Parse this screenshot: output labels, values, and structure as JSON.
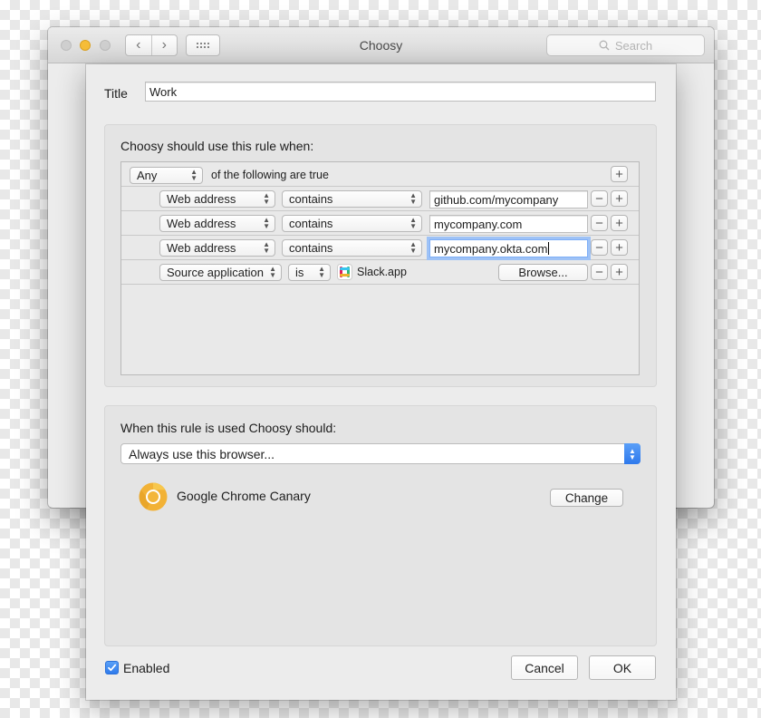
{
  "window": {
    "title": "Choosy",
    "search_placeholder": "Search"
  },
  "sheet": {
    "title_label": "Title",
    "title_value": "Work",
    "condition_header": "Choosy should use this rule when:",
    "match_mode": "Any",
    "match_suffix": "of the following are true",
    "rows": [
      {
        "field": "Web address",
        "operator": "contains",
        "value": "github.com/mycompany"
      },
      {
        "field": "Web address",
        "operator": "contains",
        "value": "mycompany.com"
      },
      {
        "field": "Web address",
        "operator": "contains",
        "value": "mycompany.okta.com"
      }
    ],
    "source_row": {
      "field": "Source application",
      "operator": "is",
      "app_name": "Slack.app",
      "browse_label": "Browse..."
    },
    "action_header": "When this rule is used Choosy should:",
    "action_value": "Always use this browser...",
    "browser_name": "Google Chrome Canary",
    "change_label": "Change",
    "enabled_label": "Enabled",
    "enabled": true,
    "cancel_label": "Cancel",
    "ok_label": "OK"
  },
  "icons": {
    "nav_back": "‹",
    "nav_forward": "›",
    "plus": "+",
    "minus": "−",
    "updown": [
      "▲",
      "▼"
    ]
  },
  "colors": {
    "accent": "#2f7bec",
    "canary": "#f2b236"
  }
}
